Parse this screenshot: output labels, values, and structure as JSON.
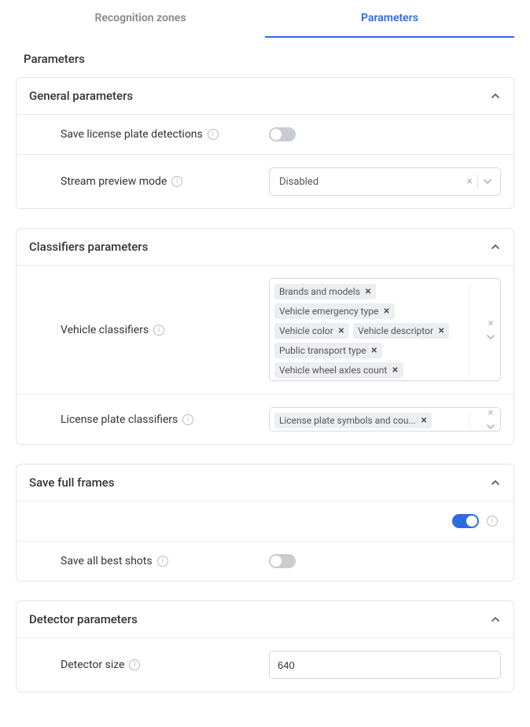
{
  "tabs": {
    "recognition": "Recognition zones",
    "parameters": "Parameters",
    "active": "parameters"
  },
  "page_title": "Parameters",
  "panels": {
    "general": {
      "title": "General parameters",
      "rows": {
        "save_lp": {
          "label": "Save license plate detections",
          "value": false
        },
        "stream_preview": {
          "label": "Stream preview mode",
          "value": "Disabled"
        }
      }
    },
    "classifiers": {
      "title": "Classifiers parameters",
      "rows": {
        "vehicle": {
          "label": "Vehicle classifiers",
          "values": [
            "Brands and models",
            "Vehicle emergency type",
            "Vehicle color",
            "Vehicle descriptor",
            "Public transport type",
            "Vehicle wheel axles count"
          ]
        },
        "license_plate": {
          "label": "License plate classifiers",
          "values": [
            "License plate symbols and cou..."
          ]
        }
      }
    },
    "save_full": {
      "title": "Save full frames",
      "main_toggle": true,
      "rows": {
        "save_all_best": {
          "label": "Save all best shots",
          "value": false
        }
      }
    },
    "detector": {
      "title": "Detector parameters",
      "rows": {
        "size": {
          "label": "Detector size",
          "value": "640"
        }
      }
    }
  }
}
